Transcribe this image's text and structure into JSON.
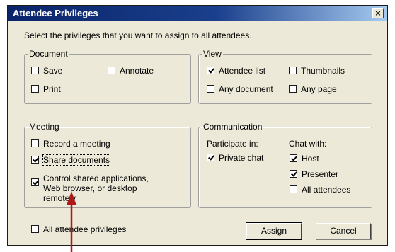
{
  "window": {
    "title": "Attendee Privileges",
    "close_label": "×"
  },
  "instruction": "Select the privileges that you want to assign to all attendees.",
  "document": {
    "legend": "Document",
    "save": {
      "label": "Save",
      "checked": false
    },
    "annotate": {
      "label": "Annotate",
      "checked": false
    },
    "print": {
      "label": "Print",
      "checked": false
    }
  },
  "view": {
    "legend": "View",
    "attendee_list": {
      "label": "Attendee list",
      "checked": true
    },
    "thumbnails": {
      "label": "Thumbnails",
      "checked": false
    },
    "any_document": {
      "label": "Any document",
      "checked": false
    },
    "any_page": {
      "label": "Any page",
      "checked": false
    }
  },
  "meeting": {
    "legend": "Meeting",
    "record": {
      "label": "Record a meeting",
      "checked": false
    },
    "share_documents": {
      "label": "Share documents",
      "checked": true
    },
    "control_shared": {
      "label": "Control shared applications, Web browser, or desktop remotely",
      "checked": true
    }
  },
  "communication": {
    "legend": "Communication",
    "participate_label": "Participate in:",
    "chat_with_label": "Chat with:",
    "private_chat": {
      "label": "Private chat",
      "checked": true
    },
    "host": {
      "label": "Host",
      "checked": true
    },
    "presenter": {
      "label": "Presenter",
      "checked": true
    },
    "all_attendees": {
      "label": "All attendees",
      "checked": false
    }
  },
  "all_privileges": {
    "label": "All attendee privileges",
    "checked": false
  },
  "buttons": {
    "assign": "Assign",
    "cancel": "Cancel"
  },
  "colors": {
    "titlebar": "#0a246a",
    "face": "#ece9d8",
    "annotation_arrow": "#b01818"
  }
}
